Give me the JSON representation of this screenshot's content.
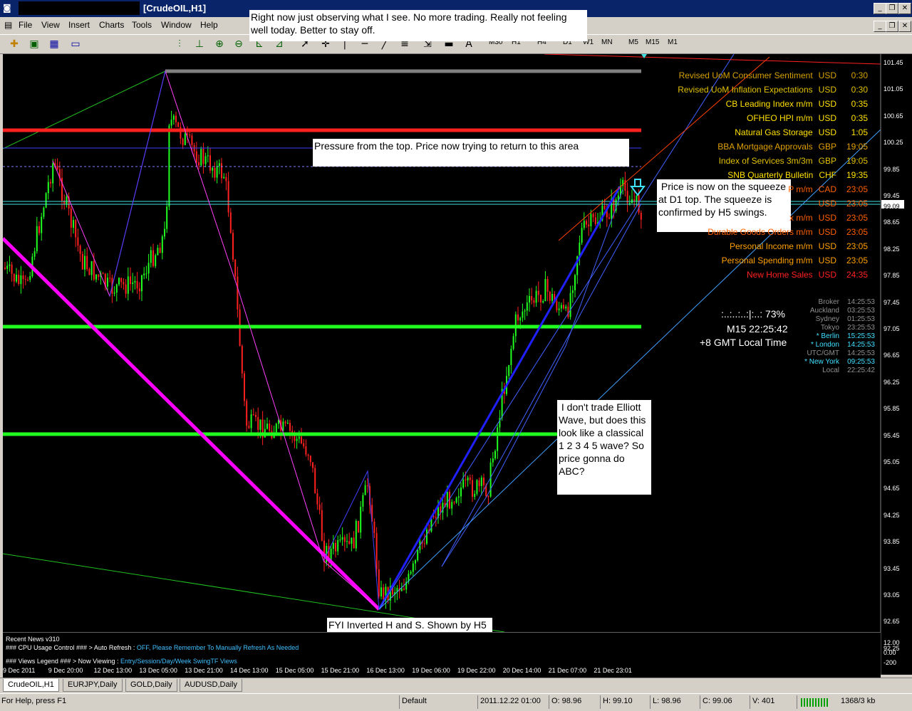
{
  "window": {
    "title": "[CrudeOIL,H1]"
  },
  "menu": [
    "File",
    "View",
    "Insert",
    "Charts",
    "Tools",
    "Window",
    "Help"
  ],
  "timeframes": [
    "M30",
    "H1",
    "H4",
    "D1",
    "W1",
    "MN",
    "M5",
    "M15",
    "M1"
  ],
  "price_axis": [
    "101.45",
    "101.05",
    "100.65",
    "100.25",
    "99.85",
    "99.45",
    "99.09",
    "98.65",
    "98.25",
    "97.85",
    "97.45",
    "97.05",
    "96.65",
    "96.25",
    "95.85",
    "95.45",
    "95.05",
    "94.65",
    "94.25",
    "93.85",
    "93.45",
    "93.05",
    "92.65",
    "92.25"
  ],
  "sub_axis": [
    "12.00",
    "0.00",
    "-200"
  ],
  "date_axis": [
    "9 Dec 2011",
    "9 Dec 20:00",
    "12 Dec 13:00",
    "13 Dec 05:00",
    "13 Dec 21:00",
    "14 Dec 13:00",
    "15 Dec 05:00",
    "15 Dec 21:00",
    "16 Dec 13:00",
    "19 Dec 06:00",
    "19 Dec 22:00",
    "20 Dec 14:00",
    "21 Dec 07:00",
    "21 Dec 23:01"
  ],
  "notes": {
    "top": "Right now just observing what I see. No more trading. Really not feeling well today. Better to stay off.",
    "pressure": "Pressure from the top. Price now trying to return to this area",
    "squeeze": " Price is now on the squeeze at D1 top. The squeeze is confirmed by H5 swings.",
    "elliott": " I don't trade Elliott Wave, but does this look like a classical 1 2 3 4 5 wave? So price gonna do ABC?",
    "hs": "FYI Inverted H and S. Shown by H5 swings running inside D1 swings"
  },
  "news": [
    {
      "event": "Revised UoM Consumer Sentiment",
      "cur": "USD",
      "time": "0:30",
      "color": "#d4a000"
    },
    {
      "event": "Revised UoM Inflation Expectations",
      "cur": "USD",
      "time": "0:30",
      "color": "#e0c000"
    },
    {
      "event": "CB Leading Index m/m",
      "cur": "USD",
      "time": "0:35",
      "color": "#ffe000"
    },
    {
      "event": "OFHEO HPI m/m",
      "cur": "USD",
      "time": "0:35",
      "color": "#ffe000"
    },
    {
      "event": "Natural Gas Storage",
      "cur": "USD",
      "time": "1:05",
      "color": "#ffe000"
    },
    {
      "event": "BBA Mortgage Approvals",
      "cur": "GBP",
      "time": "19:05",
      "color": "#e0a000"
    },
    {
      "event": "Index of Services 3m/3m",
      "cur": "GBP",
      "time": "19:05",
      "color": "#e0c000"
    },
    {
      "event": "SNB Quarterly Bulletin",
      "cur": "CHF",
      "time": "19:35",
      "color": "#ffe000"
    },
    {
      "event": "P m/m",
      "cur": "CAD",
      "time": "23:05",
      "color": "#ff6000"
    },
    {
      "event": "",
      "cur": "USD",
      "time": "23:05",
      "color": "#ff6000"
    },
    {
      "event": "x m/m",
      "cur": "USD",
      "time": "23:05",
      "color": "#ff6000"
    },
    {
      "event": "Durable Goods Orders m/m",
      "cur": "USD",
      "time": "23:05",
      "color": "#ff6000"
    },
    {
      "event": "Personal Income m/m",
      "cur": "USD",
      "time": "23:05",
      "color": "#ffa000"
    },
    {
      "event": "Personal Spending m/m",
      "cur": "USD",
      "time": "23:05",
      "color": "#ffa000"
    },
    {
      "event": "New Home Sales",
      "cur": "USD",
      "time": "24:35",
      "color": "#ff2020"
    }
  ],
  "clocks": [
    {
      "city": "Broker",
      "time": "14:25:53",
      "color": "#909090"
    },
    {
      "city": "Auckland",
      "time": "03:25:53",
      "color": "#909090"
    },
    {
      "city": "Sydney",
      "time": "01:25:53",
      "color": "#909090"
    },
    {
      "city": "Tokyo",
      "time": "23:25:53",
      "color": "#909090"
    },
    {
      "city": "* Berlin",
      "time": "15:25:53",
      "color": "#40e0ff"
    },
    {
      "city": "* London",
      "time": "14:25:53",
      "color": "#40e0ff"
    },
    {
      "city": "UTC/GMT",
      "time": "14:25:53",
      "color": "#909090"
    },
    {
      "city": "* New York",
      "time": "09:25:53",
      "color": "#40e0ff"
    },
    {
      "city": "Local",
      "time": "22:25:42",
      "color": "#909090"
    }
  ],
  "timer": {
    "bar": ":..:..:..:|:..: 73%",
    "tf": "M15 22:25:42",
    "gmt": "+8 GMT Local Time"
  },
  "current_price": "99.09",
  "news_panel": {
    "title": "Recent News v310",
    "line1_a": "### CPU Usage Control ### > Auto Refresh :",
    "line1_b": "OFF, Please Remember To Manually Refresh As Needed",
    "line2_a": "### Views Legend ### > Now Viewing :",
    "line2_b": "Entry/Session/Day/Week SwingTF Views"
  },
  "tabs": [
    "CrudeOIL,H1",
    "EURJPY,Daily",
    "GOLD,Daily",
    "AUDUSD,Daily"
  ],
  "status": {
    "help": "For Help, press F1",
    "profile": "Default",
    "datetime": "2011.12.22 01:00",
    "open": "O: 98.96",
    "high": "H: 99.10",
    "low": "L: 98.96",
    "close": "C: 99.06",
    "volume": "V: 401",
    "traffic": "1368/3 kb"
  }
}
